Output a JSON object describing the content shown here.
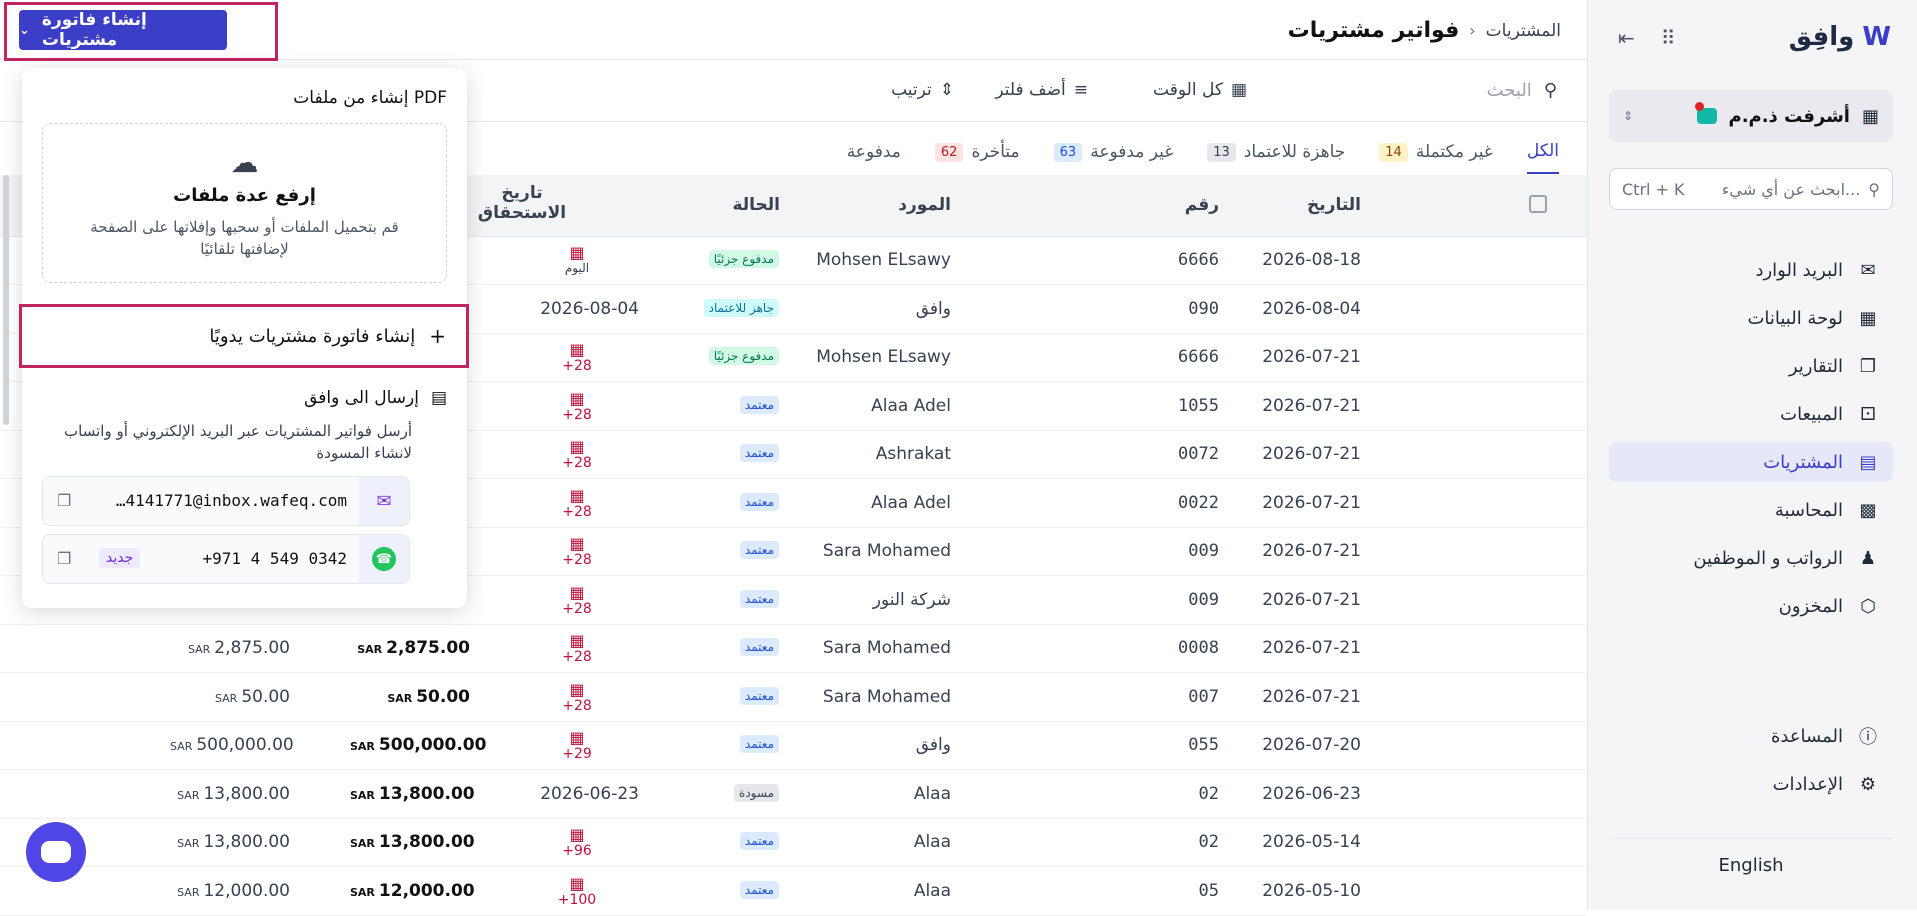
{
  "brand": {
    "name": "وافِق"
  },
  "sidebar": {
    "company": "أشرفت ذ.م.م",
    "search_placeholder": "ابحث عن أي شيء...",
    "search_shortcut": "Ctrl + K",
    "items": [
      {
        "label": "البريد الوارد",
        "icon": "inbox-icon"
      },
      {
        "label": "لوحة البيانات",
        "icon": "dashboard-icon"
      },
      {
        "label": "التقارير",
        "icon": "reports-icon"
      },
      {
        "label": "المبيعات",
        "icon": "cart-icon"
      },
      {
        "label": "المشتريات",
        "icon": "receipt-icon"
      },
      {
        "label": "المحاسبة",
        "icon": "ledger-icon"
      },
      {
        "label": "الرواتب و الموظفين",
        "icon": "people-icon"
      },
      {
        "label": "المخزون",
        "icon": "box-icon"
      }
    ],
    "bottom": [
      {
        "label": "المساعدة",
        "icon": "help-icon"
      },
      {
        "label": "الإعدادات",
        "icon": "gear-icon"
      }
    ],
    "language": "English"
  },
  "header": {
    "breadcrumb_parent": "المشتريات",
    "title": "فواتير مشتريات",
    "create_button": "إنشاء فاتورة مشتريات"
  },
  "toolbar": {
    "search_placeholder": "البحث",
    "time_filter": "كل الوقت",
    "add_filter": "أضف فلتر",
    "sort": "ترتيب"
  },
  "tabs": [
    {
      "label": "الكل",
      "count": null,
      "active": true
    },
    {
      "label": "غير مكتملة",
      "count": "14"
    },
    {
      "label": "جاهزة للاعتماد",
      "count": "13"
    },
    {
      "label": "غير مدفوعة",
      "count": "63"
    },
    {
      "label": "متأخرة",
      "count": "62"
    },
    {
      "label": "مدفوعة",
      "count": null
    }
  ],
  "table": {
    "headers": {
      "date": "التاريخ",
      "number": "رقم",
      "supplier": "المورد",
      "status": "الحالة",
      "due": "تاريخ الاستحقاق"
    },
    "currency": "SAR",
    "rows": [
      {
        "date": "2026-08-18",
        "number": "6666",
        "supplier": "Mohsen ELsawy",
        "status": "مدفوع جزئيًا",
        "status_type": "partial",
        "due": "اليوم",
        "amount": "",
        "balance": ""
      },
      {
        "date": "2026-08-04",
        "number": "090",
        "supplier": "وافق",
        "status": "جاهز للاعتماد",
        "status_type": "ready",
        "due_date": "2026-08-04",
        "amount": "",
        "balance": ""
      },
      {
        "date": "2026-07-21",
        "number": "6666",
        "supplier": "Mohsen ELsawy",
        "status": "مدفوع جزئيًا",
        "status_type": "partial",
        "due": "+28",
        "amount": "",
        "balance": ""
      },
      {
        "date": "2026-07-21",
        "number": "1055",
        "supplier": "Alaa Adel",
        "status": "معتمد",
        "status_type": "approved",
        "due": "+28",
        "amount": "",
        "balance": ""
      },
      {
        "date": "2026-07-21",
        "number": "0072",
        "supplier": "Ashrakat",
        "status": "معتمد",
        "status_type": "approved",
        "due": "+28",
        "amount": "",
        "balance": ""
      },
      {
        "date": "2026-07-21",
        "number": "0022",
        "supplier": "Alaa Adel",
        "status": "معتمد",
        "status_type": "approved",
        "due": "+28",
        "amount": "",
        "balance": ""
      },
      {
        "date": "2026-07-21",
        "number": "009",
        "supplier": "Sara Mohamed",
        "status": "معتمد",
        "status_type": "approved",
        "due": "+28",
        "amount": "",
        "balance": ""
      },
      {
        "date": "2026-07-21",
        "number": "009",
        "supplier": "شركة النور",
        "status": "معتمد",
        "status_type": "approved",
        "due": "+28",
        "amount": "",
        "balance": ""
      },
      {
        "date": "2026-07-21",
        "number": "0008",
        "supplier": "Sara Mohamed",
        "status": "معتمد",
        "status_type": "approved",
        "due": "+28",
        "amount": "2,875.00",
        "balance": "2,875.00"
      },
      {
        "date": "2026-07-21",
        "number": "007",
        "supplier": "Sara Mohamed",
        "status": "معتمد",
        "status_type": "approved",
        "due": "+28",
        "amount": "50.00",
        "balance": "50.00"
      },
      {
        "date": "2026-07-20",
        "number": "055",
        "supplier": "وافق",
        "status": "معتمد",
        "status_type": "approved",
        "due": "+29",
        "amount": "500,000.00",
        "balance": "500,000.00"
      },
      {
        "date": "2026-06-23",
        "number": "02",
        "supplier": "Alaa",
        "status": "مسودة",
        "status_type": "draft",
        "due_date": "2026-06-23",
        "amount": "13,800.00",
        "balance": "13,800.00"
      },
      {
        "date": "2026-05-14",
        "number": "02",
        "supplier": "Alaa",
        "status": "معتمد",
        "status_type": "approved",
        "due": "+96",
        "amount": "13,800.00",
        "balance": "13,800.00"
      },
      {
        "date": "2026-05-10",
        "number": "05",
        "supplier": "Alaa",
        "status": "معتمد",
        "status_type": "approved",
        "due": "+100",
        "amount": "12,000.00",
        "balance": "12,000.00"
      }
    ]
  },
  "dropdown": {
    "pdf_title": "إنشاء من ملفات PDF",
    "upload_title": "إرفع عدة ملفات",
    "upload_desc_1": "قم بتحميل الملفات أو سحبها وإفلاتها على الصفحة",
    "upload_desc_2": "لإضافتها تلقائيًا",
    "manual": "إنشاء فاتورة مشتريات يدويًا",
    "send_title": "إرسال الى وافق",
    "send_desc": "أرسل فواتير المشتريات عبر البريد الإلكتروني أو واتساب لانشاء المسودة",
    "email": "…4141771@inbox.wafeq.com",
    "whatsapp": "+971 4 549 0342",
    "new_badge": "جديد"
  }
}
